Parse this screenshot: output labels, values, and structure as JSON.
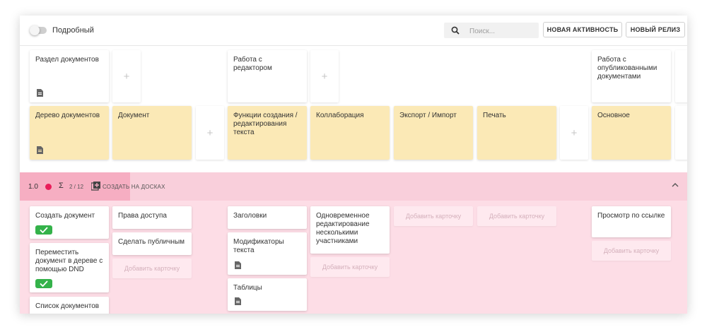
{
  "toolbar": {
    "toggle_label": "Подробный",
    "search_placeholder": "Поиск...",
    "new_activity": "НОВАЯ АКТИВНОСТЬ",
    "new_release": "НОВЫЙ РЕЛИЗ"
  },
  "activities": [
    "Раздел документов",
    "Работа с редактором",
    "Работа с опубликованными документами"
  ],
  "steps": [
    "Дерево документов",
    "Документ",
    "Функции создания / редактирования текста",
    "Коллаборация",
    "Экспорт / Импорт",
    "Печать",
    "Основное"
  ],
  "release": {
    "version": "1.0",
    "sigma": "Σ",
    "count": "2 / 12",
    "create_label": "СОЗДАТЬ НА ДОСКАХ"
  },
  "stories": {
    "col1": [
      "Создать документ",
      "Переместить документ в дереве с помощью DND",
      "Список документов"
    ],
    "col2": [
      "Права доступа",
      "Сделать публичным"
    ],
    "col3": [
      "Заголовки",
      "Модификаторы текста",
      "Таблицы"
    ],
    "col4": [
      "Одновременное редактирование несколькими участниками"
    ],
    "col7": [
      "Просмотр по ссылке"
    ]
  },
  "add_card_label": "Добавить карточку",
  "colors": {
    "band": "#fddde6",
    "band_header": "#f9cfdb",
    "band_accent": "#f6aec2",
    "step_card": "#fbe9b6",
    "check": "#34b24a",
    "dot": "#e91e5a"
  }
}
